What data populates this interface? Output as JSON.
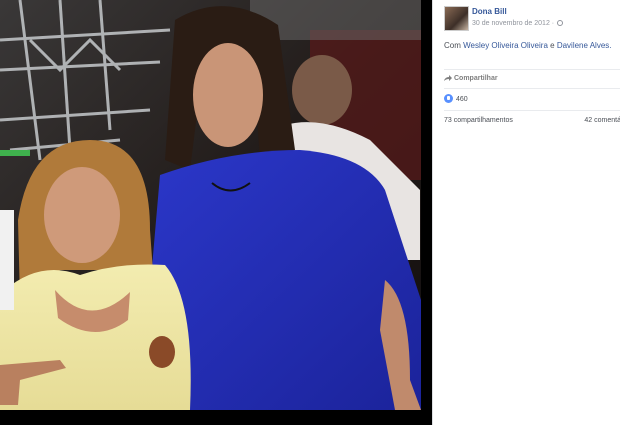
{
  "post": {
    "author": "Dona Bill",
    "date": "30 de novembro de 2012 ·",
    "caption": {
      "prefix": "Com",
      "tagged_1": "Wesley Oliveira Oliveira",
      "conjunction": "e",
      "tagged_2": "Davilene Alves."
    }
  },
  "actions": {
    "share_label": "Compartilhar"
  },
  "reactions": {
    "count": "460"
  },
  "stats": {
    "shares": "73 compartilhamentos",
    "comments": "42 comentá"
  },
  "colors": {
    "link": "#365899",
    "meta": "#90949c",
    "like": "#5890ff",
    "viewer_bg": "#000000"
  }
}
